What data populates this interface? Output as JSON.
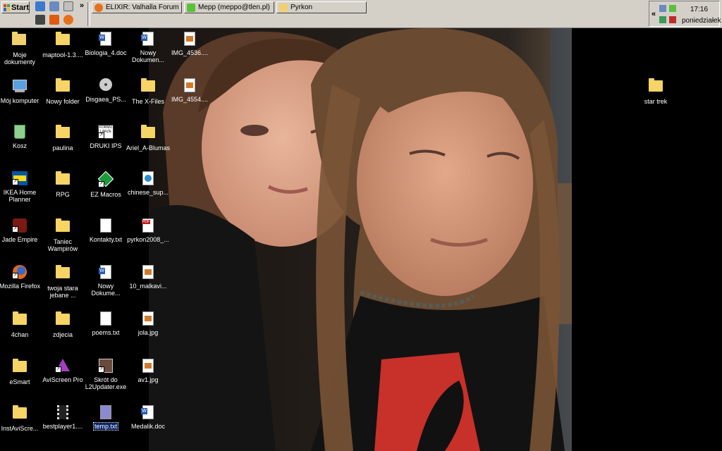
{
  "taskbar": {
    "start_label": "Start",
    "quick_launch_overflow": "»",
    "windows": [
      {
        "label": "ELIXIR: Valhalla Forum :: ..."
      },
      {
        "label": "Mepp (meppo@tlen.pl)"
      },
      {
        "label": "Pyrkon"
      }
    ],
    "tray": {
      "expand": "«",
      "time": "17:16",
      "day": "poniedziałek"
    }
  },
  "desktop": {
    "icons": [
      {
        "label": "Moje dokumenty"
      },
      {
        "label": "Mój komputer"
      },
      {
        "label": "Kosz"
      },
      {
        "label": "IKEA Home Planner"
      },
      {
        "label": "Jade Empire"
      },
      {
        "label": "Mozilla Firefox"
      },
      {
        "label": "4chan"
      },
      {
        "label": "eSmart"
      },
      {
        "label": "InstAviScre..."
      },
      {
        "label": "maptool-1.3...."
      },
      {
        "label": "Nowy folder"
      },
      {
        "label": "paulina"
      },
      {
        "label": "RPG"
      },
      {
        "label": "Taniec Wampirów"
      },
      {
        "label": "twoja stara jebane ..."
      },
      {
        "label": "zdjecia"
      },
      {
        "label": "AviScreen Pro"
      },
      {
        "label": "bestplayer1...."
      },
      {
        "label": "Biologia_4.doc"
      },
      {
        "label": "Disgaea_PS..."
      },
      {
        "label": "DRUKI IPS"
      },
      {
        "label": "EZ Macros"
      },
      {
        "label": "Kontakty.txt"
      },
      {
        "label": "Nowy Dokume..."
      },
      {
        "label": "poems.txt"
      },
      {
        "label": "Skrót do L2Updater.exe"
      },
      {
        "label": "temp.txt"
      },
      {
        "label": "Nowy Dokumen..."
      },
      {
        "label": "The X-Files"
      },
      {
        "label": "Ariel_A-Blumas"
      },
      {
        "label": "chinese_sup..."
      },
      {
        "label": "pyrkon2008_..."
      },
      {
        "label": "10_malkavi..."
      },
      {
        "label": "jola.jpg"
      },
      {
        "label": "av1.jpg"
      },
      {
        "label": "Medalik.doc"
      },
      {
        "label": "IMG_4536...."
      },
      {
        "label": "IMG_4554...."
      },
      {
        "label": "star trek"
      }
    ]
  }
}
